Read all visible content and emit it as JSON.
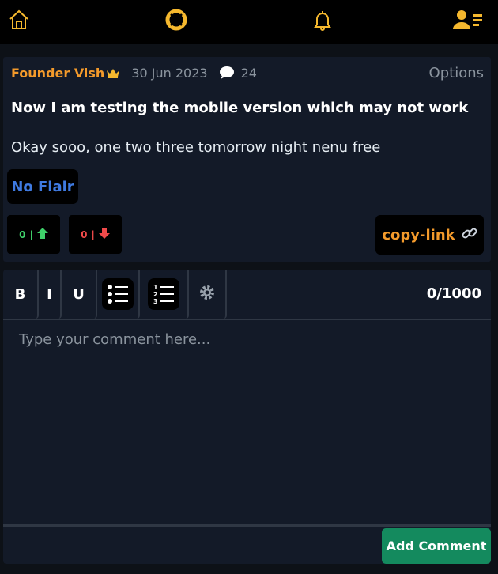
{
  "nav": {
    "icons": [
      "home-icon",
      "lifebuoy-icon",
      "bell-icon",
      "user-menu-icon"
    ],
    "accent": "#f5b82e"
  },
  "post": {
    "author": "Founder Vish",
    "date": "30 Jun 2023",
    "comment_count": "24",
    "options_label": "Options",
    "title": "Now I am testing the mobile version which may not work",
    "body": "Okay sooo, one two three tomorrow night nenu free",
    "flair": "No Flair",
    "upvotes": "0",
    "downvotes": "0",
    "copy_link_label": "copy-link"
  },
  "editor": {
    "bold_label": "B",
    "italic_label": "I",
    "underline_label": "U",
    "char_count": "0/1000",
    "placeholder": "Type your comment here...",
    "submit_label": "Add Comment"
  },
  "colors": {
    "author": "#f39a2b",
    "flair": "#3f7ae0",
    "upvote": "#3fd06a",
    "downvote": "#f04a4a",
    "submit": "#148a5e"
  }
}
